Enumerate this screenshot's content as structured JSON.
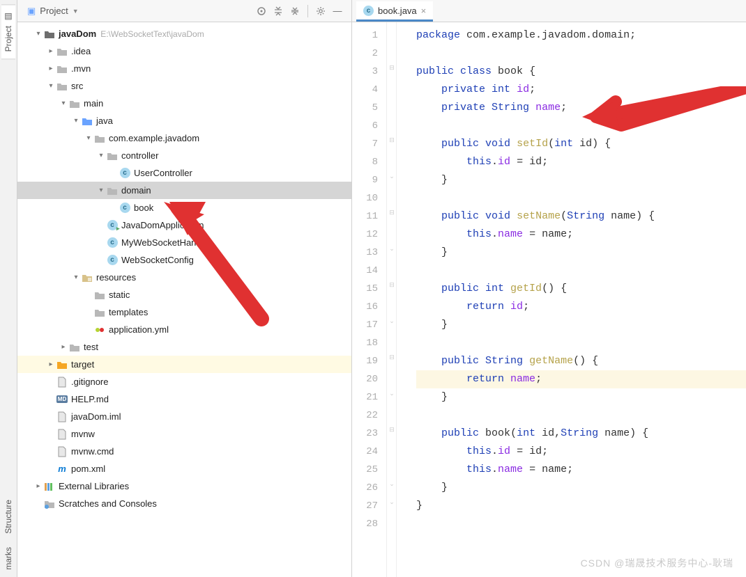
{
  "toolbar": {
    "project_label": "Project"
  },
  "tree": {
    "root": {
      "name": "javaDom",
      "path": "E:\\WebSocketText\\javaDom"
    },
    "items": [
      {
        "d": 0,
        "exp": "open",
        "icon": "folder-root",
        "label": "javaDom",
        "hint": "E:\\WebSocketText\\javaDom",
        "bold": true
      },
      {
        "d": 1,
        "exp": "closed",
        "icon": "folder-grey",
        "label": ".idea"
      },
      {
        "d": 1,
        "exp": "closed",
        "icon": "folder-grey",
        "label": ".mvn"
      },
      {
        "d": 1,
        "exp": "open",
        "icon": "folder-grey",
        "label": "src"
      },
      {
        "d": 2,
        "exp": "open",
        "icon": "folder-grey",
        "label": "main"
      },
      {
        "d": 3,
        "exp": "open",
        "icon": "folder-blue",
        "label": "java"
      },
      {
        "d": 4,
        "exp": "open",
        "icon": "folder-grey",
        "label": "com.example.javadom"
      },
      {
        "d": 5,
        "exp": "open",
        "icon": "folder-grey",
        "label": "controller"
      },
      {
        "d": 6,
        "exp": "none",
        "icon": "class",
        "label": "UserController"
      },
      {
        "d": 5,
        "exp": "open",
        "icon": "folder-grey",
        "label": "domain",
        "sel": true
      },
      {
        "d": 6,
        "exp": "none",
        "icon": "class",
        "label": "book"
      },
      {
        "d": 5,
        "exp": "none",
        "icon": "class-run",
        "label": "JavaDomApplication"
      },
      {
        "d": 5,
        "exp": "none",
        "icon": "class",
        "label": "MyWebSocketHandler"
      },
      {
        "d": 5,
        "exp": "none",
        "icon": "class",
        "label": "WebSocketConfig"
      },
      {
        "d": 3,
        "exp": "open",
        "icon": "folder-res",
        "label": "resources"
      },
      {
        "d": 4,
        "exp": "none",
        "icon": "folder-grey",
        "label": "static"
      },
      {
        "d": 4,
        "exp": "none",
        "icon": "folder-grey",
        "label": "templates"
      },
      {
        "d": 4,
        "exp": "none",
        "icon": "yml",
        "label": "application.yml"
      },
      {
        "d": 2,
        "exp": "closed",
        "icon": "folder-grey",
        "label": "test"
      },
      {
        "d": 1,
        "exp": "closed",
        "icon": "folder-orange",
        "label": "target",
        "hl": true
      },
      {
        "d": 1,
        "exp": "none",
        "icon": "file",
        "label": ".gitignore"
      },
      {
        "d": 1,
        "exp": "none",
        "icon": "md",
        "label": "HELP.md"
      },
      {
        "d": 1,
        "exp": "none",
        "icon": "file",
        "label": "javaDom.iml"
      },
      {
        "d": 1,
        "exp": "none",
        "icon": "file",
        "label": "mvnw"
      },
      {
        "d": 1,
        "exp": "none",
        "icon": "file",
        "label": "mvnw.cmd"
      },
      {
        "d": 1,
        "exp": "none",
        "icon": "maven",
        "label": "pom.xml"
      },
      {
        "d": 0,
        "exp": "closed",
        "icon": "lib",
        "label": "External Libraries"
      },
      {
        "d": 0,
        "exp": "none",
        "icon": "scratch",
        "label": "Scratches and Consoles"
      }
    ]
  },
  "tabs": [
    {
      "icon": "class",
      "label": "book.java"
    }
  ],
  "code": {
    "lines": [
      {
        "n": 1,
        "html": "<span class='kw'>package</span> <span class='pkg'>com.example.javadom.domain</span>;"
      },
      {
        "n": 2,
        "html": ""
      },
      {
        "n": 3,
        "html": "<span class='kw'>public class</span> <span class='cls'>book</span> {"
      },
      {
        "n": 4,
        "html": "    <span class='kw'>private int</span> <span class='ident'>id</span>;"
      },
      {
        "n": 5,
        "html": "    <span class='kw'>private</span> <span class='typ'>String</span> <span class='ident'>name</span>;"
      },
      {
        "n": 6,
        "html": ""
      },
      {
        "n": 7,
        "html": "    <span class='kw'>public void</span> <span class='method'>setId</span>(<span class='kw'>int</span> id) {"
      },
      {
        "n": 8,
        "html": "        <span class='this'>this</span>.<span class='ident'>id</span> = id;"
      },
      {
        "n": 9,
        "html": "    }"
      },
      {
        "n": 10,
        "html": ""
      },
      {
        "n": 11,
        "html": "    <span class='kw'>public void</span> <span class='method'>setName</span>(<span class='typ'>String</span> name) {"
      },
      {
        "n": 12,
        "html": "        <span class='this'>this</span>.<span class='ident'>name</span> = name;"
      },
      {
        "n": 13,
        "html": "    }"
      },
      {
        "n": 14,
        "html": ""
      },
      {
        "n": 15,
        "html": "    <span class='kw'>public int</span> <span class='method'>getId</span>() {"
      },
      {
        "n": 16,
        "html": "        <span class='kw'>return</span> <span class='ident'>id</span>;"
      },
      {
        "n": 17,
        "html": "    }"
      },
      {
        "n": 18,
        "html": ""
      },
      {
        "n": 19,
        "html": "    <span class='kw'>public</span> <span class='typ'>String</span> <span class='method'>getName</span>() {"
      },
      {
        "n": 20,
        "html": "        <span class='kw'>return</span> <span class='ident'>name</span>;",
        "hl": true
      },
      {
        "n": 21,
        "html": "    }"
      },
      {
        "n": 22,
        "html": ""
      },
      {
        "n": 23,
        "html": "    <span class='kw'>public</span> <span class='cls'>book</span>(<span class='kw'>int</span> id,<span class='typ'>String</span> name) {"
      },
      {
        "n": 24,
        "html": "        <span class='this'>this</span>.<span class='ident'>id</span> = id;"
      },
      {
        "n": 25,
        "html": "        <span class='this'>this</span>.<span class='ident'>name</span> = name;"
      },
      {
        "n": 26,
        "html": "    }"
      },
      {
        "n": 27,
        "html": "}"
      },
      {
        "n": 28,
        "html": ""
      }
    ]
  },
  "rail": {
    "project": "Project",
    "structure": "Structure",
    "bookmarks": "marks"
  },
  "watermark": "CSDN @瑞晟技术服务中心-耿瑞"
}
